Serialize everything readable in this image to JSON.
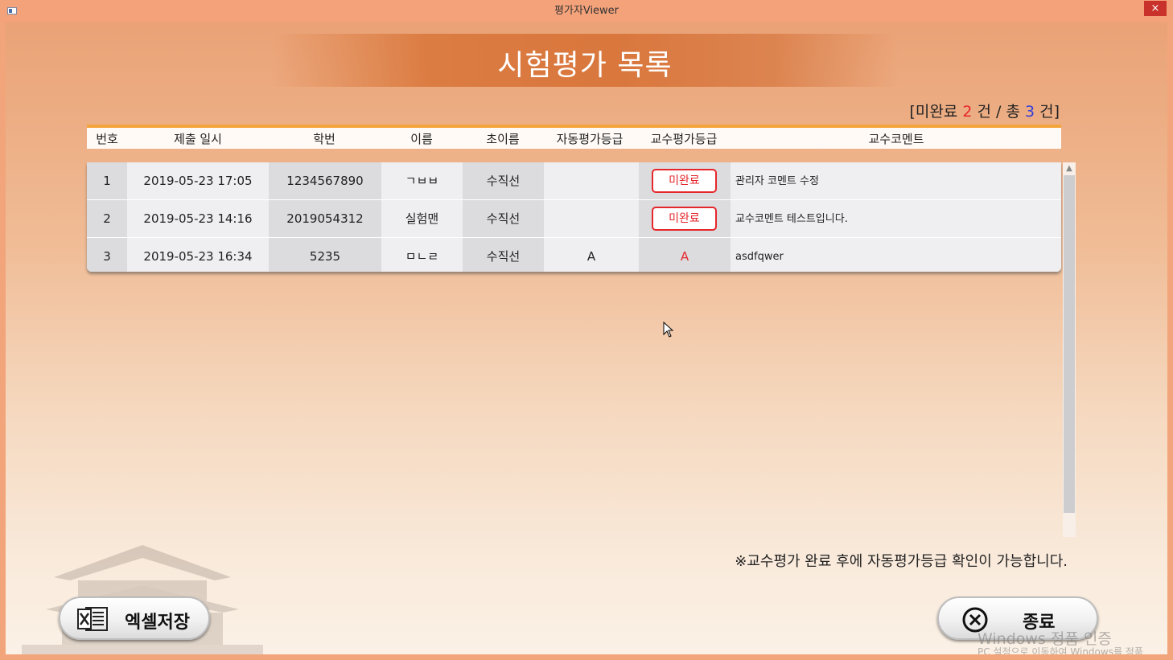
{
  "window": {
    "title": "평가자Viewer",
    "close_glyph": "×"
  },
  "page_title": "시험평가 목록",
  "summary": {
    "prefix": "[미완료 ",
    "pending": "2",
    "mid": " 건 / 총 ",
    "total": "3",
    "suffix": " 건]"
  },
  "table": {
    "columns": [
      "번호",
      "제출 일시",
      "학번",
      "이름",
      "초이름",
      "자동평가등급",
      "교수평가등급",
      "교수코멘트"
    ],
    "rows": [
      {
        "no": "1",
        "datetime": "2019-05-23 17:05",
        "student_id": "1234567890",
        "name": "ㄱㅂㅂ",
        "initial": "수직선",
        "auto_grade": "",
        "prof_grade": "미완료",
        "prof_grade_pending": true,
        "comment": "관리자 코멘트 수정"
      },
      {
        "no": "2",
        "datetime": "2019-05-23 14:16",
        "student_id": "2019054312",
        "name": "실험맨",
        "initial": "수직선",
        "auto_grade": "",
        "prof_grade": "미완료",
        "prof_grade_pending": true,
        "comment": "교수코멘트 테스트입니다."
      },
      {
        "no": "3",
        "datetime": "2019-05-23 16:34",
        "student_id": "5235",
        "name": "ㅁㄴㄹ",
        "initial": "수직선",
        "auto_grade": "A",
        "prof_grade": "A",
        "prof_grade_pending": false,
        "comment": "asdfqwer"
      }
    ]
  },
  "note": "※교수평가 완료 후에 자동평가등급 확인이 가능합니다.",
  "buttons": {
    "excel_label": "엑셀저장",
    "exit_label": "종료"
  },
  "watermark": {
    "line1": "Windows 정품 인증",
    "line2": "PC 설정으로 이동하여 Windows를 정품"
  },
  "icons": {
    "excel": "excel-icon",
    "exit": "close-circle-icon",
    "app": "app-window-icon",
    "scroll_up": "scroll-up-icon"
  },
  "colors": {
    "accent_orange": "#db7c42",
    "header_stripe": "#f5a43a",
    "pending_red": "#e5262a",
    "total_blue": "#3440d8"
  }
}
